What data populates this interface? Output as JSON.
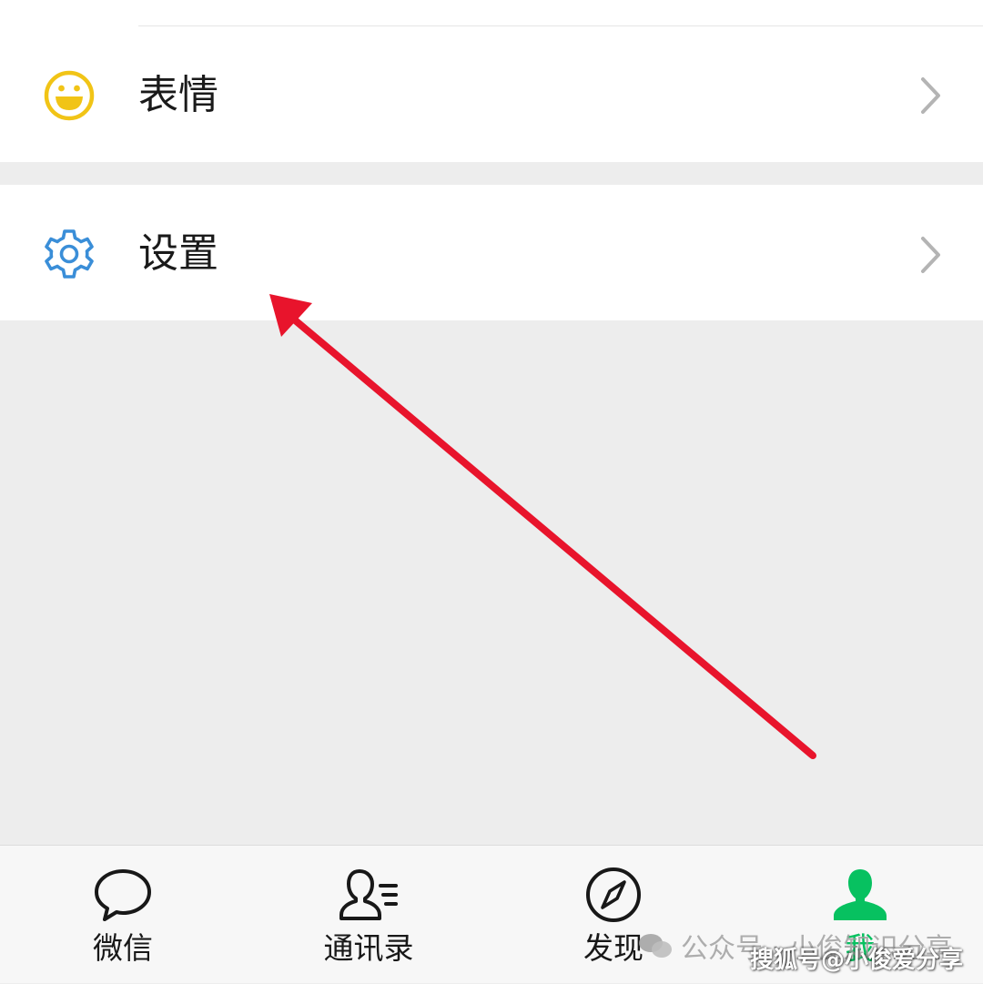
{
  "menu": {
    "emoji_label": "表情",
    "settings_label": "设置"
  },
  "tabbar": {
    "tabs": [
      {
        "label": "微信",
        "icon": "chat-bubble-icon",
        "active": false
      },
      {
        "label": "通讯录",
        "icon": "contacts-icon",
        "active": false
      },
      {
        "label": "发现",
        "icon": "compass-icon",
        "active": false
      },
      {
        "label": "我",
        "icon": "person-icon",
        "active": true
      }
    ]
  },
  "watermark": {
    "account_text": "公众号 · 小俊知识分享",
    "sohu_text": "搜狐号@小俊爱分享"
  },
  "colors": {
    "accent_green": "#07c160",
    "emoji_yellow": "#f1c416",
    "settings_blue": "#3a8ed8",
    "arrow_red": "#e8142c",
    "page_background": "#ededed"
  }
}
